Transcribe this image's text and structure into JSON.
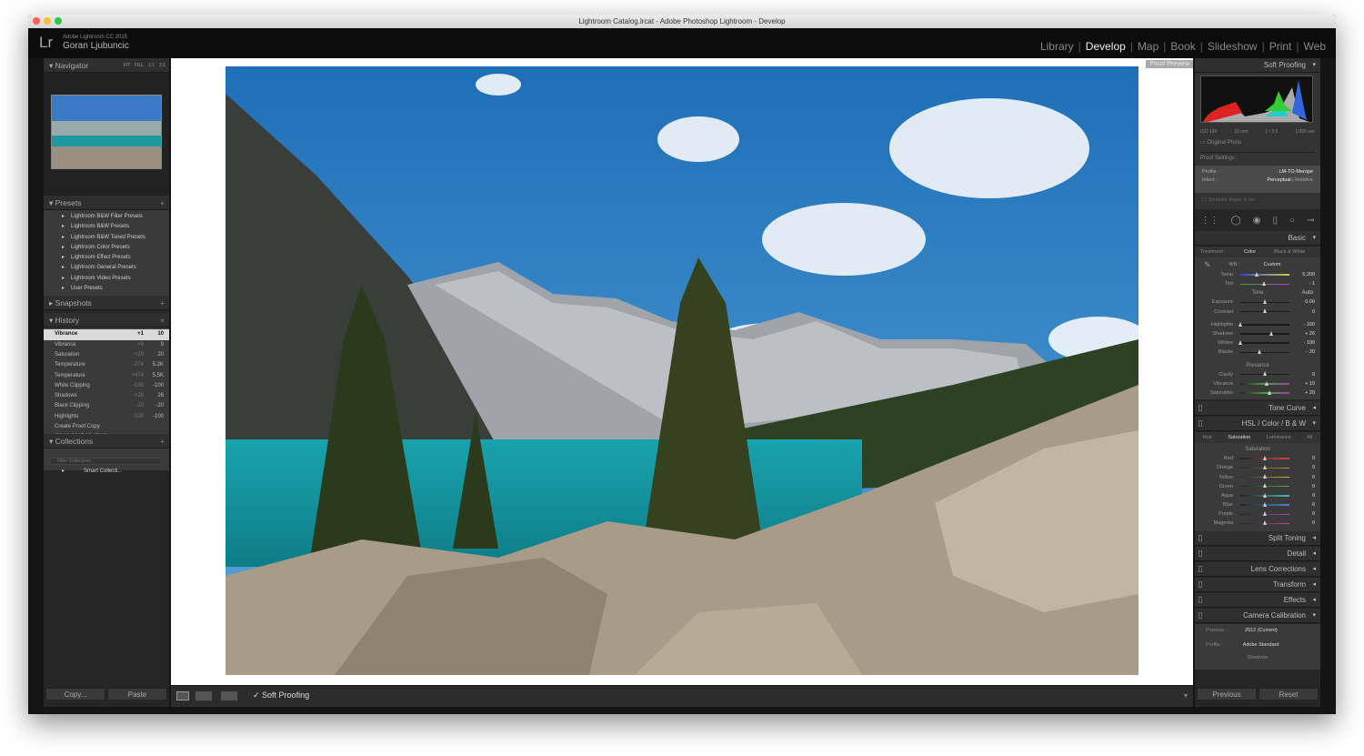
{
  "window": {
    "title": "Lightroom Catalog.lrcat - Adobe Photoshop Lightroom - Develop"
  },
  "header": {
    "logo": "Lr",
    "product": "Adobe Lightroom CC 2015",
    "user": "Goran Ljubuncic",
    "modules": [
      {
        "label": "Library"
      },
      {
        "label": "Develop",
        "active": true
      },
      {
        "label": "Map"
      },
      {
        "label": "Book"
      },
      {
        "label": "Slideshow"
      },
      {
        "label": "Print"
      },
      {
        "label": "Web"
      }
    ]
  },
  "left": {
    "navigator": {
      "title": "Navigator",
      "zoom_options": [
        "FIT",
        "FILL",
        "1:1",
        "3:1"
      ]
    },
    "presets": {
      "title": "Presets",
      "items": [
        "Lightroom B&W Filter Presets",
        "Lightroom B&W Presets",
        "Lightroom B&W Toned Presets",
        "Lightroom Color Presets",
        "Lightroom Effect Presets",
        "Lightroom General Presets",
        "Lightroom Video Presets",
        "User Presets"
      ]
    },
    "snapshots": {
      "title": "Snapshots"
    },
    "history": {
      "title": "History",
      "items": [
        {
          "name": "Vibrance",
          "delta": "+1",
          "value": "10"
        },
        {
          "name": "Vibrance",
          "delta": "+9",
          "value": "9"
        },
        {
          "name": "Saturation",
          "delta": "+20",
          "value": "20"
        },
        {
          "name": "Temperature",
          "delta": "-274",
          "value": "5.2K"
        },
        {
          "name": "Temperature",
          "delta": "+474",
          "value": "5.5K"
        },
        {
          "name": "White Clipping",
          "delta": "-100",
          "value": "-100"
        },
        {
          "name": "Shadows",
          "delta": "+26",
          "value": "26"
        },
        {
          "name": "Black Clipping",
          "delta": "-20",
          "value": "-20"
        },
        {
          "name": "Highlights",
          "delta": "-100",
          "value": "-100"
        },
        {
          "name": "Create Proof Copy (09/10/2017 19:47:22)",
          "delta": "",
          "value": ""
        }
      ]
    },
    "collections": {
      "title": "Collections",
      "filter_placeholder": "Filter Collections",
      "items": [
        "Smart Collecti..."
      ]
    },
    "copy": "Copy...",
    "paste": "Paste"
  },
  "center": {
    "proof_preview": "Proof Preview"
  },
  "toolbar": {
    "soft_proofing": "Soft Proofing",
    "checked": true
  },
  "right": {
    "soft_proofing_title": "Soft Proofing",
    "histogram": {
      "iso": "ISO 100",
      "focal": "10 mm",
      "aperture": "ƒ / 3.5",
      "shutter": "1/200 sec"
    },
    "original_photo": "Original Photo",
    "proof_settings": "Proof Settings :",
    "profile_label": "Profile :",
    "profile": "LM-TO-Merope",
    "intent_label": "Intent :",
    "intent_a": "Perceptual",
    "intent_b": "Relative",
    "simulate": "Simulate Paper & Ink",
    "basic": {
      "title": "Basic",
      "treatment_label": "Treatment :",
      "color": "Color",
      "bw": "Black & White",
      "wb_label": "WB :",
      "wb": "Custom",
      "tone": "Tone",
      "auto": "Auto",
      "presence": "Presence",
      "wb_sliders": [
        {
          "label": "Temp",
          "value": "5,200",
          "pos": 0.35
        },
        {
          "label": "Tint",
          "value": "- 1",
          "pos": 0.49
        }
      ],
      "tone_sliders": [
        {
          "label": "Exposure",
          "value": "0.00",
          "pos": 0.5
        },
        {
          "label": "Contrast",
          "value": "0",
          "pos": 0.5
        }
      ],
      "tone2_sliders": [
        {
          "label": "Highlights",
          "value": "- 100",
          "pos": 0
        },
        {
          "label": "Shadows",
          "value": "+ 26",
          "pos": 0.63
        },
        {
          "label": "Whites",
          "value": "- 100",
          "pos": 0
        },
        {
          "label": "Blacks",
          "value": "- 20",
          "pos": 0.4
        }
      ],
      "presence_sliders": [
        {
          "label": "Clarity",
          "value": "0",
          "pos": 0.5
        },
        {
          "label": "Vibrance",
          "value": "+ 10",
          "pos": 0.55
        },
        {
          "label": "Saturation",
          "value": "+ 20",
          "pos": 0.6
        }
      ]
    },
    "tone_curve": "Tone Curve",
    "hsl": {
      "title": "HSL / Color / B & W",
      "tabs": [
        "Hue",
        "Saturation",
        "Luminance",
        "All"
      ],
      "section": "Saturation",
      "sliders": [
        {
          "label": "Red",
          "value": "0",
          "color": "#c44"
        },
        {
          "label": "Orange",
          "value": "0",
          "color": "#c84"
        },
        {
          "label": "Yellow",
          "value": "0",
          "color": "#cb4"
        },
        {
          "label": "Green",
          "value": "0",
          "color": "#4b4"
        },
        {
          "label": "Aqua",
          "value": "0",
          "color": "#4bb"
        },
        {
          "label": "Blue",
          "value": "0",
          "color": "#48c"
        },
        {
          "label": "Purple",
          "value": "0",
          "color": "#a4c"
        },
        {
          "label": "Magenta",
          "value": "0",
          "color": "#c4a"
        }
      ]
    },
    "panels": [
      "Split Toning",
      "Detail",
      "Lens Corrections",
      "Transform",
      "Effects"
    ],
    "calibration": {
      "title": "Camera Calibration",
      "process_label": "Process :",
      "process": "2012 (Current)",
      "profile_label": "Profile :",
      "profile": "Adobe Standard",
      "shadows": "Shadows"
    },
    "previous": "Previous",
    "reset": "Reset"
  }
}
